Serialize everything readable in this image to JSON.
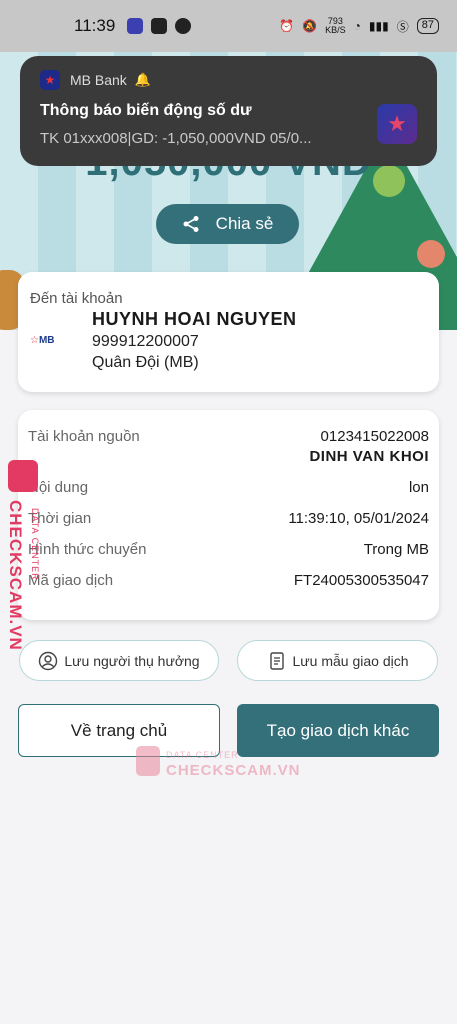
{
  "status_bar": {
    "time": "11:39",
    "network_speed_value": "793",
    "network_speed_unit": "KB/S",
    "battery": "87"
  },
  "notification": {
    "app_name": "MB Bank",
    "title": "Thông báo biến động số dư",
    "body": "TK 01xxx008|GD: -1,050,000VND 05/0..."
  },
  "amount": "1,050,000 VND",
  "share": {
    "label": "Chia sẻ"
  },
  "destination": {
    "label": "Đến tài khoản",
    "bank_logo_text": "MB",
    "name": "HUYNH HOAI NGUYEN",
    "account_number": "999912200007",
    "bank_name": "Quân Đội (MB)"
  },
  "details": {
    "source_label": "Tài khoản nguồn",
    "source_account": "0123415022008",
    "source_name": "DINH VAN KHOI",
    "content_label": "Nội dung",
    "content_value": "lon",
    "time_label": "Thời gian",
    "time_value": "11:39:10, 05/01/2024",
    "method_label": "Hình thức chuyển",
    "method_value": "Trong MB",
    "txn_label": "Mã giao dịch",
    "txn_value": "FT24005300535047"
  },
  "actions": {
    "save_beneficiary": "Lưu người thụ hưởng",
    "save_template": "Lưu mẫu giao dịch",
    "home": "Về trang chủ",
    "new_transaction": "Tạo giao dịch khác"
  },
  "watermark": {
    "brand": "CHECKSCAM.VN",
    "sub": "DATA CENTER"
  },
  "colors": {
    "primary": "#34707a",
    "watermark": "#e23a62",
    "notification_bg": "#3a3a3a"
  }
}
